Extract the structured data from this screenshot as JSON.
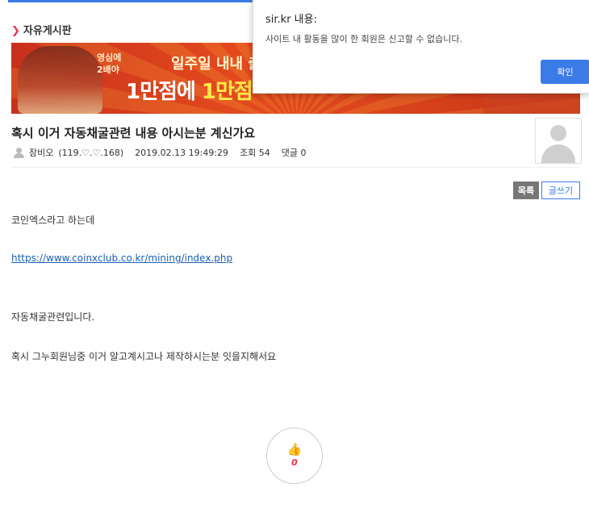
{
  "board": {
    "title": "자유게시판",
    "arrow_icon": "chevron-right-icon"
  },
  "banner": {
    "small_line_1": "영심에",
    "small_line_2": "2배야",
    "line_1": "일주일 내내 출",
    "line_2_a": "1만점",
    "line_2_b": "에 ",
    "line_2_c": "1만점"
  },
  "post": {
    "title": "혹시 이거 자동채굴관련 내용 아시는분 계신가요",
    "author": "잠비오",
    "ip": "(119.♡.♡.168)",
    "datetime": "2019.02.13 19:49:29",
    "views": "조회 54",
    "comments": "댓글 0",
    "body_line_1": "코인엑스라고 하는데",
    "link": "https://www.coinxclub.co.kr/mining/index.php",
    "body_line_2": "자동채굴관련입니다.",
    "body_line_3": "혹시 그누회원님중 이거 알고계시고나 제작하시는분 잇을지해서요"
  },
  "buttons": {
    "list": "목록",
    "write": "글쓰기"
  },
  "like": {
    "count": "0",
    "icon": "thumbs-up-icon"
  },
  "dialog": {
    "title": "sir.kr 내용:",
    "message": "사이트 내 활동을 많이 한 회원은 신고할 수 없습니다.",
    "ok": "확인"
  },
  "colors": {
    "accent": "#3b7be8",
    "like": "#e8334a",
    "banner": "#d8421c"
  }
}
